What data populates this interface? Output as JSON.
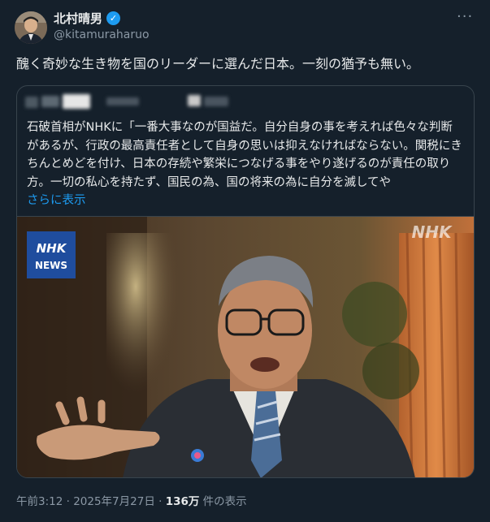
{
  "tweet": {
    "author_name": "北村晴男",
    "handle": "@kitamuraharuo",
    "text": "醜く奇妙な生き物を国のリーダーに選んだ日本。一刻の猶予も無い。",
    "more_icon": "ellipsis-icon",
    "verified_icon": "verified-badge-icon"
  },
  "quote": {
    "lines": [
      "石破首相がNHKに「一番大事なのが国益だ。自分自身の事を考えれば色々な判断",
      "があるが、行政の最高責任者として自身の思いは抑えなければならない。関税にき",
      "ちんとめどを付け、日本の存続や繁栄につなげる事をやり遂げるのが責任の取り",
      "方。一切の私心を持たず、国民の為、国の将来の為に自分を滅してや"
    ],
    "show_more": "さらに表示",
    "media": {
      "logo_top": "NHK",
      "logo_bottom": "NEWS",
      "watermark": "NHK"
    }
  },
  "footer": {
    "time": "午前3:12",
    "sep1": " · ",
    "date": "2025年7月27日",
    "sep2": " · ",
    "views": "136万",
    "views_label": " 件の表示"
  },
  "colors": {
    "background": "#15202b",
    "text": "#e7e9ea",
    "secondary": "#8b98a5",
    "accent": "#1d9bf0",
    "nhk_blue": "#1f4d9e"
  }
}
